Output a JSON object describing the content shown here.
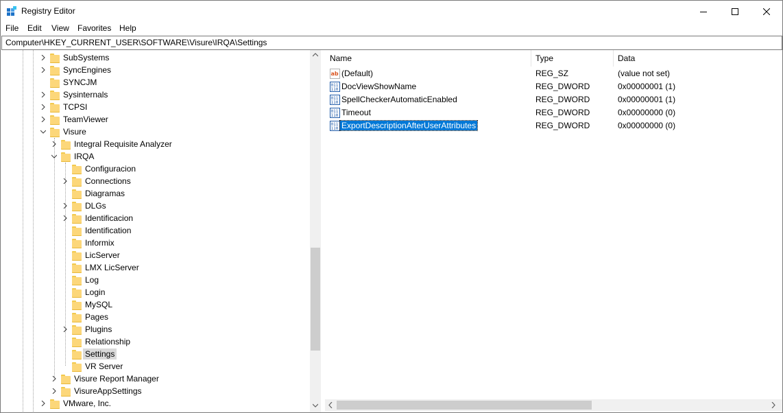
{
  "window": {
    "title": "Registry Editor"
  },
  "menu": [
    "File",
    "Edit",
    "View",
    "Favorites",
    "Help"
  ],
  "address": "Computer\\HKEY_CURRENT_USER\\SOFTWARE\\Visure\\IRQA\\Settings",
  "tree": [
    {
      "label": "SubSystems",
      "level": 0,
      "expander": "collapsed"
    },
    {
      "label": "SyncEngines",
      "level": 0,
      "expander": "collapsed"
    },
    {
      "label": "SYNCJM",
      "level": 0,
      "expander": "none"
    },
    {
      "label": "Sysinternals",
      "level": 0,
      "expander": "collapsed"
    },
    {
      "label": "TCPSI",
      "level": 0,
      "expander": "collapsed"
    },
    {
      "label": "TeamViewer",
      "level": 0,
      "expander": "collapsed"
    },
    {
      "label": "Visure",
      "level": 0,
      "expander": "expanded"
    },
    {
      "label": "Integral Requisite Analyzer",
      "level": 1,
      "expander": "collapsed"
    },
    {
      "label": "IRQA",
      "level": 1,
      "expander": "expanded"
    },
    {
      "label": "Configuracion",
      "level": 2,
      "expander": "none"
    },
    {
      "label": "Connections",
      "level": 2,
      "expander": "collapsed"
    },
    {
      "label": "Diagramas",
      "level": 2,
      "expander": "none"
    },
    {
      "label": "DLGs",
      "level": 2,
      "expander": "collapsed"
    },
    {
      "label": "Identificacion",
      "level": 2,
      "expander": "collapsed"
    },
    {
      "label": "Identification",
      "level": 2,
      "expander": "none"
    },
    {
      "label": "Informix",
      "level": 2,
      "expander": "none"
    },
    {
      "label": "LicServer",
      "level": 2,
      "expander": "none"
    },
    {
      "label": "LMX LicServer",
      "level": 2,
      "expander": "none"
    },
    {
      "label": "Log",
      "level": 2,
      "expander": "none"
    },
    {
      "label": "Login",
      "level": 2,
      "expander": "none"
    },
    {
      "label": "MySQL",
      "level": 2,
      "expander": "none"
    },
    {
      "label": "Pages",
      "level": 2,
      "expander": "none"
    },
    {
      "label": "Plugins",
      "level": 2,
      "expander": "collapsed"
    },
    {
      "label": "Relationship",
      "level": 2,
      "expander": "none"
    },
    {
      "label": "Settings",
      "level": 2,
      "expander": "none",
      "selected": true
    },
    {
      "label": "VR Server",
      "level": 2,
      "expander": "none"
    },
    {
      "label": "Visure Report Manager",
      "level": 1,
      "expander": "collapsed"
    },
    {
      "label": "VisureAppSettings",
      "level": 1,
      "expander": "collapsed"
    },
    {
      "label": "VMware, Inc.",
      "level": 0,
      "expander": "collapsed"
    }
  ],
  "columns": {
    "name": "Name",
    "type": "Type",
    "data": "Data"
  },
  "values": [
    {
      "icon": "string-value-icon",
      "name": "(Default)",
      "type": "REG_SZ",
      "data": "(value not set)"
    },
    {
      "icon": "dword-value-icon",
      "name": "DocViewShowName",
      "type": "REG_DWORD",
      "data": "0x00000001 (1)"
    },
    {
      "icon": "dword-value-icon",
      "name": "SpellCheckerAutomaticEnabled",
      "type": "REG_DWORD",
      "data": "0x00000001 (1)"
    },
    {
      "icon": "dword-value-icon",
      "name": "Timeout",
      "type": "REG_DWORD",
      "data": "0x00000000 (0)"
    },
    {
      "icon": "dword-value-icon",
      "name": "ExportDescriptionAfterUserAttributes",
      "type": "REG_DWORD",
      "data": "0x00000000 (0)",
      "selected": true
    }
  ],
  "colors": {
    "selection": "#0078d7",
    "folder": "#fcd77a",
    "tree_selection": "#d9d9d9"
  }
}
